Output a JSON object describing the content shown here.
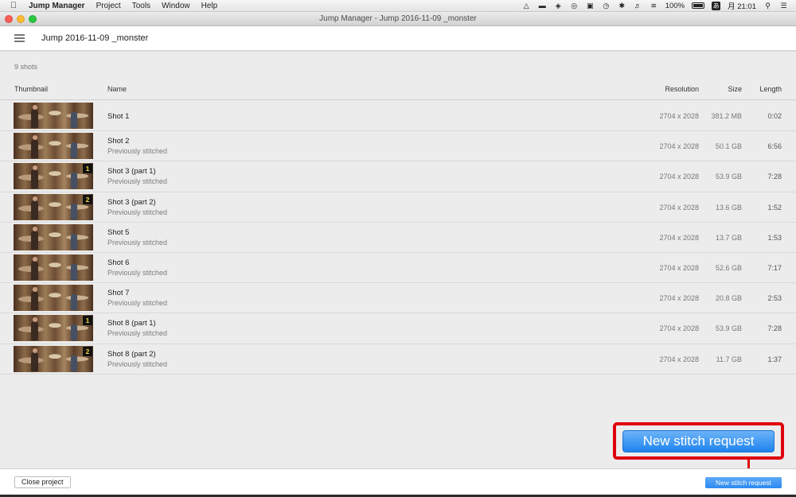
{
  "menubar": {
    "app_name": "Jump Manager",
    "menus": [
      "Project",
      "Tools",
      "Window",
      "Help"
    ],
    "battery_percent": "100%",
    "ime_label": "あ",
    "clock": "月 21:01"
  },
  "window": {
    "title": "Jump Manager - Jump 2016-11-09 _monster"
  },
  "header": {
    "project_title": "Jump 2016-11-09 _monster"
  },
  "content": {
    "shot_count": "9 shots",
    "columns": {
      "thumbnail": "Thumbnail",
      "name": "Name",
      "resolution": "Resolution",
      "size": "Size",
      "length": "Length"
    },
    "shots": [
      {
        "name": "Shot 1",
        "status": "",
        "badge": "",
        "resolution": "2704 x 2028",
        "size": "381.2 MB",
        "length": "0:02"
      },
      {
        "name": "Shot 2",
        "status": "Previously stitched",
        "badge": "",
        "resolution": "2704 x 2028",
        "size": "50.1 GB",
        "length": "6:56"
      },
      {
        "name": "Shot 3 (part 1)",
        "status": "Previously stitched",
        "badge": "1",
        "resolution": "2704 x 2028",
        "size": "53.9 GB",
        "length": "7:28"
      },
      {
        "name": "Shot 3 (part 2)",
        "status": "Previously stitched",
        "badge": "2",
        "resolution": "2704 x 2028",
        "size": "13.6 GB",
        "length": "1:52"
      },
      {
        "name": "Shot 5",
        "status": "Previously stitched",
        "badge": "",
        "resolution": "2704 x 2028",
        "size": "13.7 GB",
        "length": "1:53"
      },
      {
        "name": "Shot 6",
        "status": "Previously stitched",
        "badge": "",
        "resolution": "2704 x 2028",
        "size": "52.6 GB",
        "length": "7:17"
      },
      {
        "name": "Shot 7",
        "status": "Previously stitched",
        "badge": "",
        "resolution": "2704 x 2028",
        "size": "20.8 GB",
        "length": "2:53"
      },
      {
        "name": "Shot 8 (part 1)",
        "status": "Previously stitched",
        "badge": "1",
        "resolution": "2704 x 2028",
        "size": "53.9 GB",
        "length": "7:28"
      },
      {
        "name": "Shot 8 (part 2)",
        "status": "Previously stitched",
        "badge": "2",
        "resolution": "2704 x 2028",
        "size": "11.7 GB",
        "length": "1:37"
      }
    ]
  },
  "callout": {
    "label": "New stitch request",
    "color": "#e0000c"
  },
  "footer": {
    "close_label": "Close project",
    "stitch_label": "New stitch request"
  },
  "colors": {
    "accent": "#2b8af0",
    "badge_text": "#f7d34a"
  }
}
